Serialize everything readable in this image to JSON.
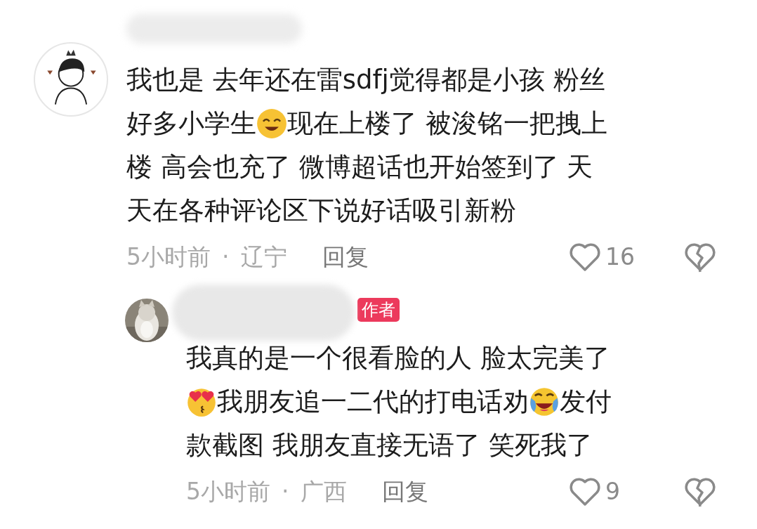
{
  "comments": [
    {
      "kind": "comment",
      "lines": [
        [
          {
            "kind": "text",
            "text": "我也是 去年还在雷sdfj觉得都是小孩 粉丝"
          }
        ],
        [
          {
            "kind": "text",
            "text": "好多小学生"
          },
          {
            "kind": "smile"
          },
          {
            "kind": "text",
            "text": "现在上楼了 被浚铭一把拽上"
          }
        ],
        [
          {
            "kind": "text",
            "text": "楼 高会也充了 微博超话也开始签到了 天"
          }
        ],
        [
          {
            "kind": "text",
            "text": "天在各种评论区下说好话吸引新粉"
          }
        ]
      ],
      "time": "5小时前",
      "separator": "·",
      "location": "辽宁",
      "reply": "回复",
      "likes": "16",
      "liked": false
    },
    {
      "kind": "reply",
      "badge": "作者",
      "lines": [
        [
          {
            "kind": "text",
            "text": "我真的是一个很看脸的人 脸太完美了"
          }
        ],
        [
          {
            "kind": "hearteyes"
          },
          {
            "kind": "text",
            "text": "我朋友追一二代的打电话劝"
          },
          {
            "kind": "laughcry"
          },
          {
            "kind": "text",
            "text": "发付"
          }
        ],
        [
          {
            "kind": "text",
            "text": "款截图 我朋友直接无语了 笑死我了"
          }
        ]
      ],
      "time": "5小时前",
      "separator": "·",
      "location": "广西",
      "reply": "回复",
      "likes": "9",
      "liked": false
    }
  ]
}
